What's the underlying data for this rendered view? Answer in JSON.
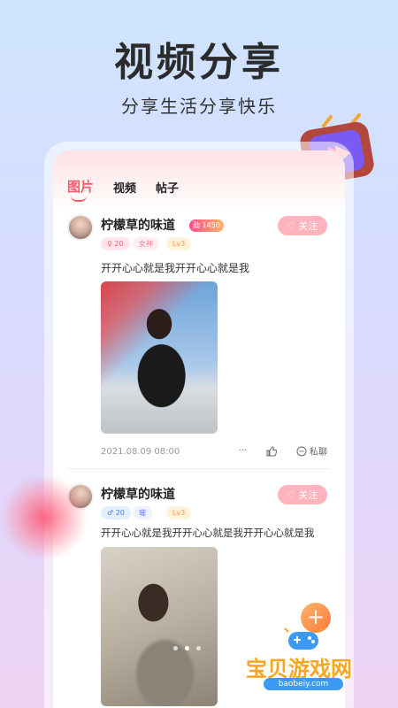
{
  "hero": {
    "title": "视频分享",
    "subtitle": "分享生活分享快乐"
  },
  "tabs": [
    {
      "label": "图片"
    },
    {
      "label": "视频"
    },
    {
      "label": "帖子"
    }
  ],
  "posts": [
    {
      "username": "柠檬草的味道",
      "rank_badge": "勋 1450",
      "likes": "20",
      "gender_tag": "女神",
      "level": "Lv3",
      "follow_label": "关注",
      "text": "开开心心就是我开开心心就是我",
      "date": "2021.08.09 08:00",
      "more": "···",
      "chat_label": "私聊"
    },
    {
      "username": "柠檬草的味道",
      "likes": "20",
      "gender_tag": "璀",
      "level": "Lv3",
      "follow_label": "关注",
      "text": "开开心心就是我开开心心就是我开开心心就是我"
    }
  ],
  "fab": {
    "label": "+"
  },
  "watermark": {
    "name": "宝贝游戏网",
    "url": "baobeiy.com"
  },
  "colors": {
    "accent": "#ff5a6e",
    "follow_bg": "#ffb3bd",
    "fab": "#ff8a3c"
  }
}
